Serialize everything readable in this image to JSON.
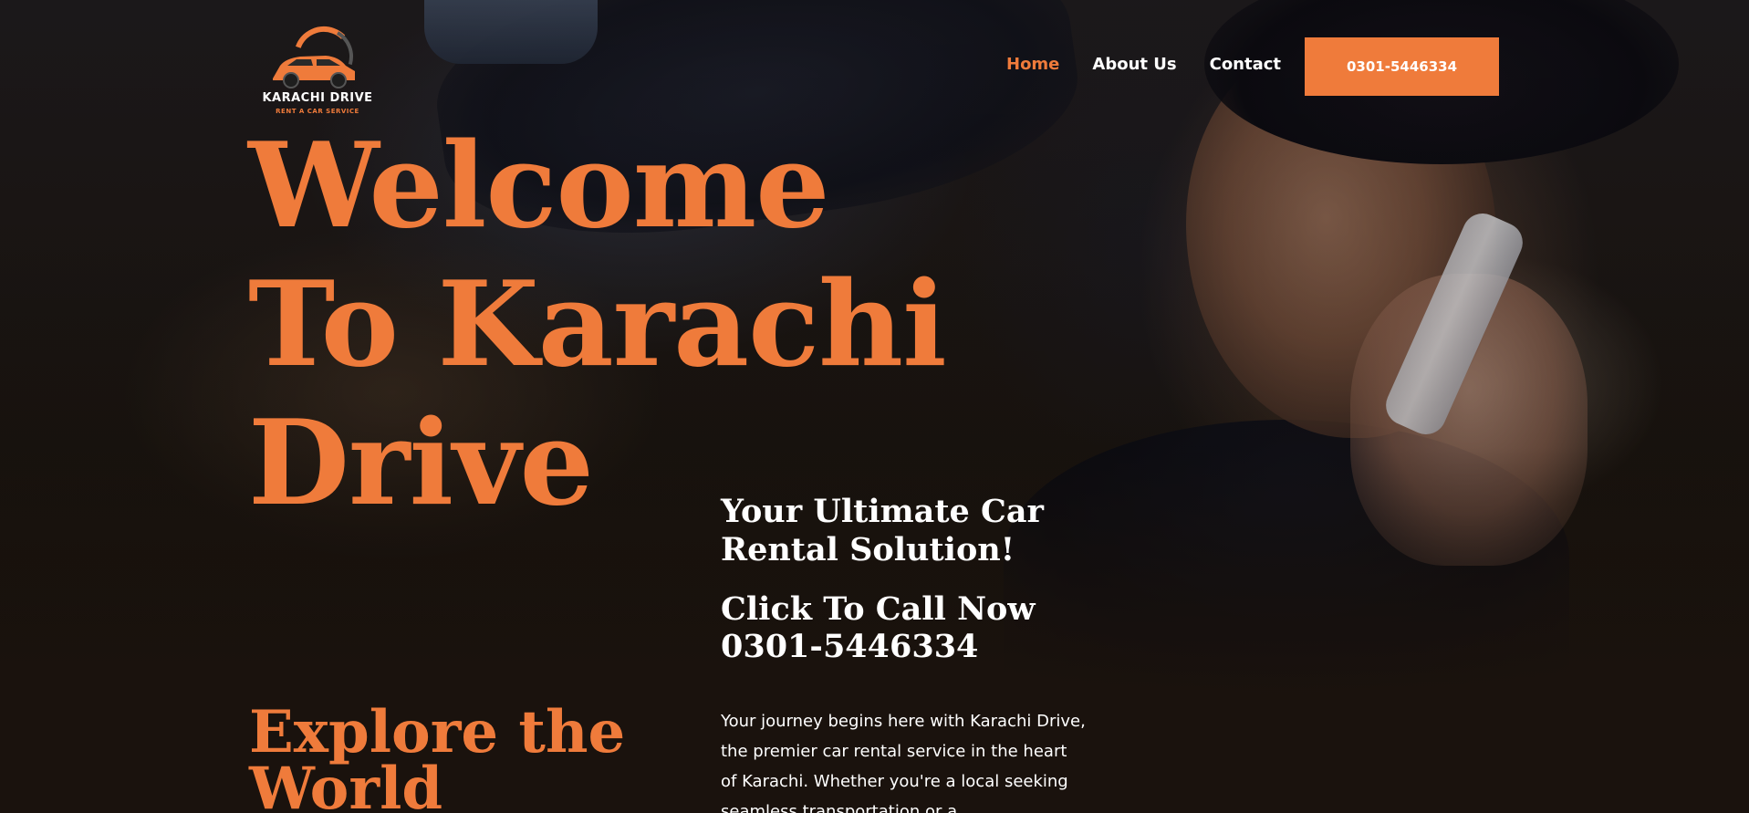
{
  "brand": {
    "name": "KARACHI DRIVE",
    "tagline": "RENT A CAR SERVICE",
    "accent_color": "#ef7b3b",
    "logo_icon": "car-logo-icon"
  },
  "nav": {
    "items": [
      {
        "label": "Home",
        "active": true
      },
      {
        "label": "About Us",
        "active": false
      },
      {
        "label": "Contact",
        "active": false
      }
    ],
    "cta_label": "0301-5446334"
  },
  "hero": {
    "title_lines": [
      "Welcome",
      "To Karachi",
      "Drive"
    ],
    "subheading_lines": [
      "Your Ultimate Car",
      "Rental Solution!"
    ],
    "call_lines": [
      "Click To Call Now",
      "0301-5446334"
    ],
    "intro_text": "Your journey begins here with Karachi Drive, the premier car rental service in the heart of Karachi. Whether you're a local seeking seamless transportation or a",
    "explore_lines": [
      "Explore the",
      "World"
    ]
  }
}
